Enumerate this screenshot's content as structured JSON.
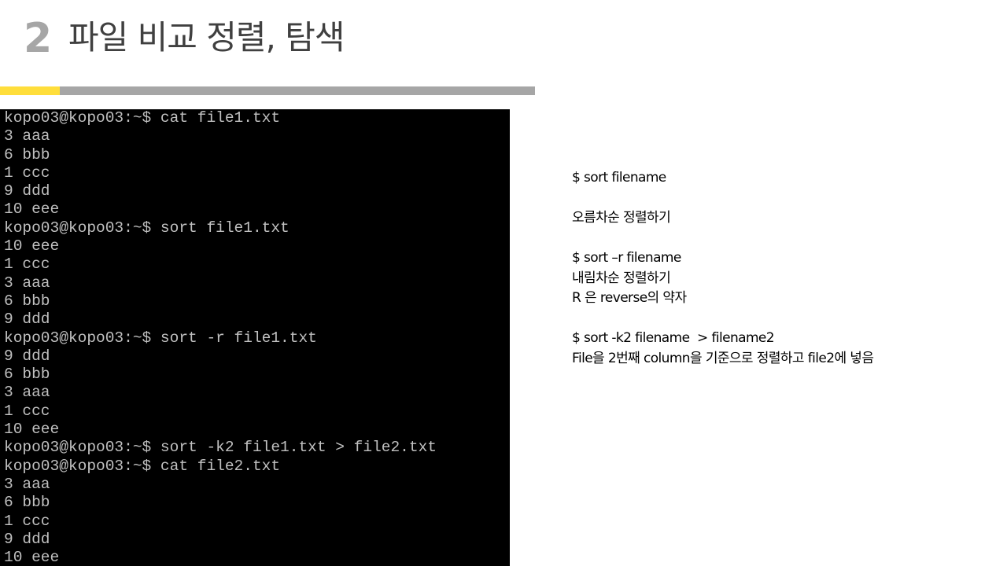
{
  "header": {
    "number": "2",
    "title": "파일 비교 정렬, 탐색"
  },
  "colors": {
    "accent": "#ffde3b",
    "bar": "#a6a6a6",
    "terminal_bg": "#000000",
    "terminal_text": "#c0c0c0"
  },
  "terminal": {
    "lines": [
      "kopo03@kopo03:~$ cat file1.txt",
      "3 aaa",
      "6 bbb",
      "1 ccc",
      "9 ddd",
      "10 eee",
      "kopo03@kopo03:~$ sort file1.txt",
      "10 eee",
      "1 ccc",
      "3 aaa",
      "6 bbb",
      "9 ddd",
      "kopo03@kopo03:~$ sort -r file1.txt",
      "9 ddd",
      "6 bbb",
      "3 aaa",
      "1 ccc",
      "10 eee",
      "kopo03@kopo03:~$ sort -k2 file1.txt > file2.txt",
      "kopo03@kopo03:~$ cat file2.txt",
      "3 aaa",
      "6 bbb",
      "1 ccc",
      "9 ddd",
      "10 eee"
    ]
  },
  "notes": {
    "sort_cmd": "$ sort filename",
    "sort_desc": "오름차순 정렬하기",
    "reverse_cmd": "$ sort –r filename",
    "reverse_desc": "내림차순 정렬하기",
    "reverse_abbr": "R 은 reverse의 약자",
    "key_cmd": "$ sort -k2 filename  > filename2",
    "key_desc": "File을 2번째 column을 기준으로 정렬하고 file2에 넣음"
  }
}
